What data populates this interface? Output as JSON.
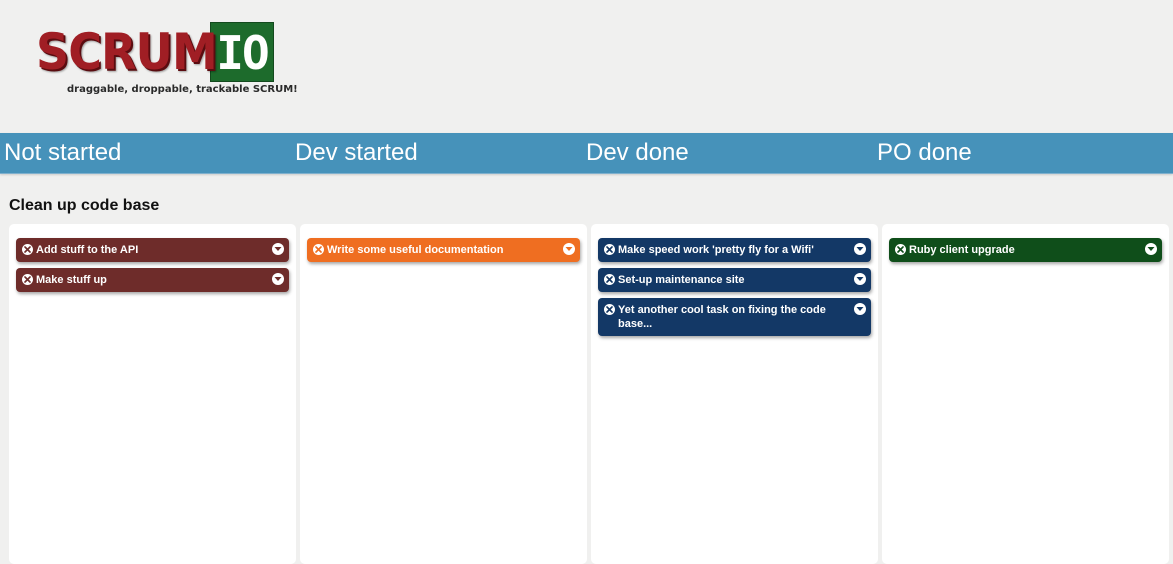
{
  "header": {
    "logo_scrum": "SCRUM",
    "logo_io": "IO",
    "tagline": "draggable, droppable, trackable SCRUM!"
  },
  "columns": [
    {
      "label": "Not started"
    },
    {
      "label": "Dev started"
    },
    {
      "label": "Dev done"
    },
    {
      "label": "PO done"
    }
  ],
  "story": {
    "title": "Clean up code base",
    "lanes": [
      {
        "color": "#6e2c2a",
        "tasks": [
          {
            "title": "Add stuff to the API"
          },
          {
            "title": "Make stuff up"
          }
        ]
      },
      {
        "color": "#ef6e21",
        "tasks": [
          {
            "title": "Write some useful documentation"
          }
        ]
      },
      {
        "color": "#133866",
        "tasks": [
          {
            "title": "Make speed work 'pretty fly for a Wifi'"
          },
          {
            "title": "Set-up maintenance site"
          },
          {
            "title": "Yet another cool task on fixing the code base..."
          }
        ]
      },
      {
        "color": "#0f4e1a",
        "tasks": [
          {
            "title": "Ruby client upgrade"
          }
        ]
      }
    ]
  },
  "icons": {
    "close": "close-icon",
    "menu": "chevron-down-icon"
  }
}
